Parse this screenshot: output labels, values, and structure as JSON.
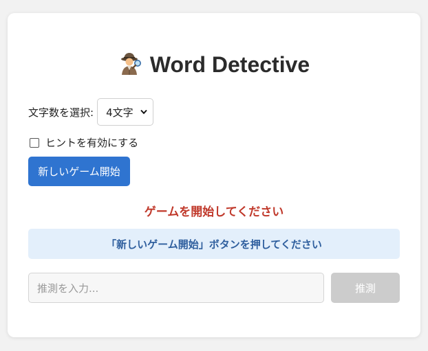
{
  "header": {
    "title": "Word Detective",
    "emoji_icon": "detective-icon"
  },
  "settings": {
    "word_length_label": "文字数を選択:",
    "word_length_selected": "4文字",
    "hint_label": "ヒントを有効にする",
    "hint_checked": false
  },
  "actions": {
    "new_game_label": "新しいゲーム開始",
    "guess_label": "推測"
  },
  "status": {
    "message": "ゲームを開始してください",
    "info": "「新しいゲーム開始」ボタンを押してください"
  },
  "guess": {
    "placeholder": "推測を入力..."
  },
  "colors": {
    "accent": "#2f74d0",
    "status_red": "#c0392b",
    "info_bg": "#e3effb",
    "info_text": "#2f5f9e",
    "disabled": "#cccccc"
  }
}
